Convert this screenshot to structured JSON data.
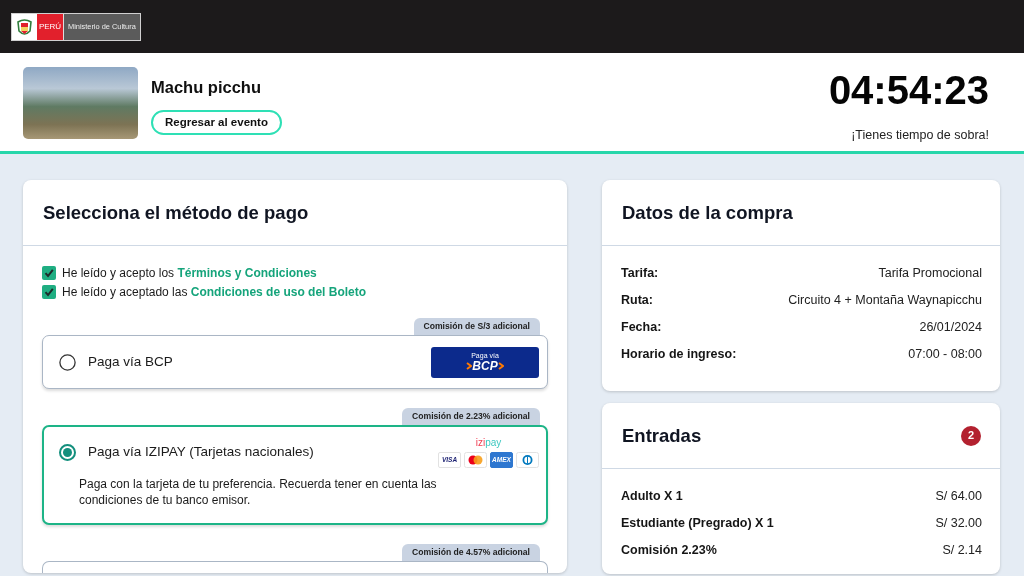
{
  "navbar": {
    "logo": {
      "country": "PERÚ",
      "ministry": "Ministerio de Cultura"
    }
  },
  "event": {
    "title": "Machu picchu",
    "back_button": "Regresar al evento"
  },
  "timer": {
    "time": "04:54:23",
    "message": "¡Tienes tiempo de sobra!"
  },
  "payment": {
    "title": "Selecciona el método de pago",
    "agreements": [
      {
        "text": "He leído y acepto los",
        "link": "Términos y Condiciones",
        "checked": true
      },
      {
        "text": "He leído y aceptado las",
        "link": "Condiciones de uso del Boleto",
        "checked": true
      }
    ],
    "options": [
      {
        "fee": "Comisión de S/3 adicional",
        "label": "Paga vía BCP",
        "selected": false,
        "kind": "bcp",
        "logo": {
          "caption": "Paga vía",
          "wordmark": "BCP"
        }
      },
      {
        "fee": "Comisión de 2.23% adicional",
        "label": "Paga vía IZIPAY (Tarjetas nacionales)",
        "selected": true,
        "kind": "izipay",
        "logo": {
          "parts": [
            "izi",
            "pay"
          ]
        },
        "cards": [
          {
            "kind": "visa",
            "text": "VISA"
          },
          {
            "kind": "mastercard"
          },
          {
            "kind": "amex",
            "text": "AMEX"
          },
          {
            "kind": "diners"
          }
        ],
        "description": "Paga con la tarjeta de tu preferencia. Recuerda tener en cuenta las condiciones de tu banco emisor."
      },
      {
        "fee": "Comisión de 4.57% adicional",
        "selected": false
      }
    ]
  },
  "purchase": {
    "title": "Datos de la compra",
    "rows": [
      {
        "label": "Tarifa:",
        "value": "Tarifa Promocional"
      },
      {
        "label": "Ruta:",
        "value": "Circuito 4 + Montaña Waynapicchu"
      },
      {
        "label": "Fecha:",
        "value": "26/01/2024"
      },
      {
        "label": "Horario de ingreso:",
        "value": "07:00 - 08:00"
      }
    ]
  },
  "tickets": {
    "title": "Entradas",
    "count": "2",
    "rows": [
      {
        "label": "Adulto X 1",
        "price": "S/ 64.00"
      },
      {
        "label": "Estudiante (Pregrado) X 1",
        "price": "S/ 32.00"
      },
      {
        "label": "Comisión 2.23%",
        "price": "S/ 2.14"
      }
    ]
  }
}
